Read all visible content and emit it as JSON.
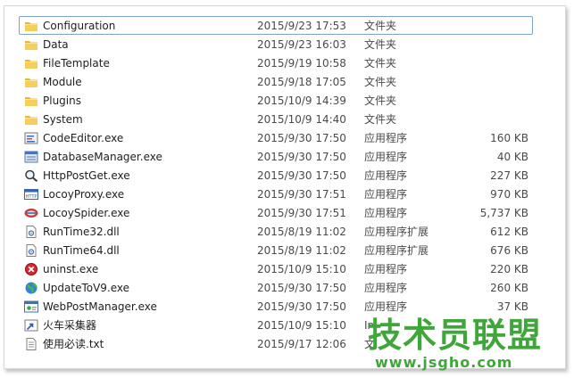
{
  "files": [
    {
      "name": "Configuration",
      "date": "2015/9/23 17:53",
      "type": "文件夹",
      "size": "",
      "icon": "folder-icon",
      "selected": true
    },
    {
      "name": "Data",
      "date": "2015/9/23 16:03",
      "type": "文件夹",
      "size": "",
      "icon": "folder-icon"
    },
    {
      "name": "FileTemplate",
      "date": "2015/9/19 10:58",
      "type": "文件夹",
      "size": "",
      "icon": "folder-icon"
    },
    {
      "name": "Module",
      "date": "2015/9/18 17:05",
      "type": "文件夹",
      "size": "",
      "icon": "folder-icon"
    },
    {
      "name": "Plugins",
      "date": "2015/10/9 14:39",
      "type": "文件夹",
      "size": "",
      "icon": "folder-icon"
    },
    {
      "name": "System",
      "date": "2015/10/9 14:40",
      "type": "文件夹",
      "size": "",
      "icon": "folder-icon"
    },
    {
      "name": "CodeEditor.exe",
      "date": "2015/9/30 17:50",
      "type": "应用程序",
      "size": "160 KB",
      "icon": "code-editor-icon"
    },
    {
      "name": "DatabaseManager.exe",
      "date": "2015/9/30 17:50",
      "type": "应用程序",
      "size": "40 KB",
      "icon": "database-icon"
    },
    {
      "name": "HttpPostGet.exe",
      "date": "2015/9/30 17:50",
      "type": "应用程序",
      "size": "227 KB",
      "icon": "magnifier-icon"
    },
    {
      "name": "LocoyProxy.exe",
      "date": "2015/9/30 17:51",
      "type": "应用程序",
      "size": "970 KB",
      "icon": "http-proxy-icon"
    },
    {
      "name": "LocoySpider.exe",
      "date": "2015/9/30 17:51",
      "type": "应用程序",
      "size": "5,737 KB",
      "icon": "train-icon"
    },
    {
      "name": "RunTime32.dll",
      "date": "2015/8/19 11:02",
      "type": "应用程序扩展",
      "size": "612 KB",
      "icon": "dll-icon"
    },
    {
      "name": "RunTime64.dll",
      "date": "2015/8/19 11:02",
      "type": "应用程序扩展",
      "size": "676 KB",
      "icon": "dll-icon"
    },
    {
      "name": "uninst.exe",
      "date": "2015/10/9 15:10",
      "type": "应用程序",
      "size": "220 KB",
      "icon": "uninstall-icon"
    },
    {
      "name": "UpdateToV9.exe",
      "date": "2015/9/30 17:50",
      "type": "应用程序",
      "size": "260 KB",
      "icon": "globe-icon"
    },
    {
      "name": "WebPostManager.exe",
      "date": "2015/9/30 17:50",
      "type": "应用程序",
      "size": "37 KB",
      "icon": "web-post-icon"
    },
    {
      "name": "火车采集器",
      "date": "2015/10/9 15:10",
      "type": "Int",
      "size": "",
      "icon": "shortcut-icon"
    },
    {
      "name": "使用必读.txt",
      "date": "2015/9/17 12:06",
      "type": "文",
      "size": "",
      "icon": "text-file-icon"
    }
  ],
  "watermark": {
    "title": "技术员联盟",
    "url": "www.jsgho.com",
    "color": "#3fa73a"
  }
}
